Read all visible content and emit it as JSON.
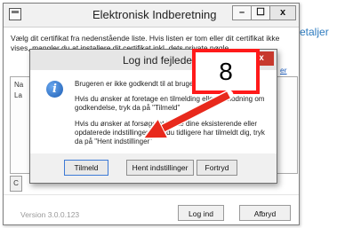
{
  "background": {
    "right_text": "etaljer"
  },
  "window": {
    "title": "Elektronisk Indberetning",
    "min_glyph": "–",
    "max_glyph": "☐",
    "close_glyph": "x",
    "intro_text": "Vælg dit certifikat fra nedenstående liste. Hvis listen er tom eller dit certifikat ikke vises, mangler du at installere dit certifikat inkl. dets private nøgle.",
    "intro_link": "er",
    "cert_header_1": "Na",
    "cert_header_2": "La",
    "side_button": "C",
    "version": "Version 3.0.0.123",
    "login_button": "Log ind",
    "cancel_button": "Afbryd"
  },
  "dialog": {
    "title": "Log ind fejlede",
    "close_glyph": "x",
    "icon": "info-icon",
    "message_1": "Brugeren er ikke godkendt til at bruge",
    "message_2": "Hvis du ønsker at foretage en tilmelding eller anmodning om godkendelse, tryk da på \"Tilmeld\"",
    "message_3": "Hvis du ønsker at forsøge at hente dine eksisterende eller opdaterede indstillinger, hvis du tidligere har tilmeldt dig, tryk da på \"Hent indstillinger\"",
    "buttons": {
      "tilmeld": "Tilmeld",
      "hent": "Hent indstillinger",
      "fortryd": "Fortryd"
    }
  },
  "annotation": {
    "number": "8",
    "box_color": "#ff1a1a",
    "arrow_color": "#e8291c"
  }
}
